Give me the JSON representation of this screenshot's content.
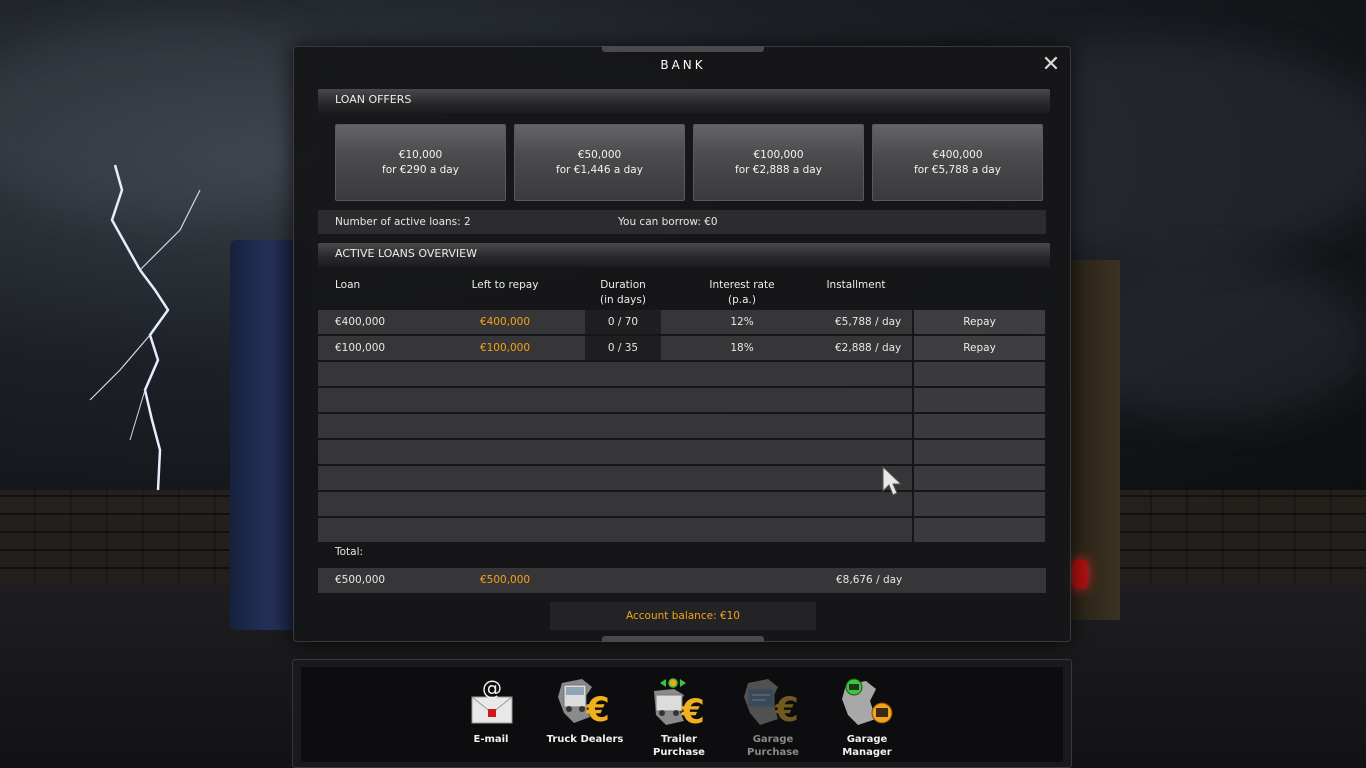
{
  "window": {
    "title": "BANK",
    "close_symbol": "✕"
  },
  "loan_offers": {
    "header": "LOAN OFFERS",
    "offers": [
      {
        "amount": "€10,000",
        "rate": "for €290 a day"
      },
      {
        "amount": "€50,000",
        "rate": "for €1,446 a day"
      },
      {
        "amount": "€100,000",
        "rate": "for €2,888 a day"
      },
      {
        "amount": "€400,000",
        "rate": "for €5,788 a day"
      }
    ]
  },
  "status": {
    "active_loans": "Number of active loans: 2",
    "can_borrow": "You can borrow: €0"
  },
  "overview": {
    "header": "ACTIVE LOANS OVERVIEW",
    "columns": {
      "loan": "Loan",
      "left": "Left to repay",
      "duration_1": "Duration",
      "duration_2": "(in days)",
      "interest_1": "Interest rate",
      "interest_2": "(p.a.)",
      "installment": "Installment"
    },
    "rows": [
      {
        "loan": "€400,000",
        "left": "€400,000",
        "duration": "0 / 70",
        "interest": "12%",
        "installment": "€5,788 / day",
        "action": "Repay"
      },
      {
        "loan": "€100,000",
        "left": "€100,000",
        "duration": "0 / 35",
        "interest": "18%",
        "installment": "€2,888 / day",
        "action": "Repay"
      }
    ],
    "total_label": "Total:",
    "total": {
      "loan": "€500,000",
      "left": "€500,000",
      "installment": "€8,676 / day"
    }
  },
  "account_balance": "Account balance: €10",
  "dock": {
    "items": [
      {
        "label_1": "E-mail",
        "label_2": "",
        "icon": "email-icon"
      },
      {
        "label_1": "Truck Dealers",
        "label_2": "",
        "icon": "truck-dealers-icon"
      },
      {
        "label_1": "Trailer",
        "label_2": "Purchase",
        "icon": "trailer-purchase-icon"
      },
      {
        "label_1": "Garage",
        "label_2": "Purchase",
        "icon": "garage-purchase-icon"
      },
      {
        "label_1": "Garage",
        "label_2": "Manager",
        "icon": "garage-manager-icon"
      }
    ]
  },
  "colors": {
    "accent": "#f4a21a",
    "panel": "#363638",
    "header": "#2a2a2c"
  }
}
